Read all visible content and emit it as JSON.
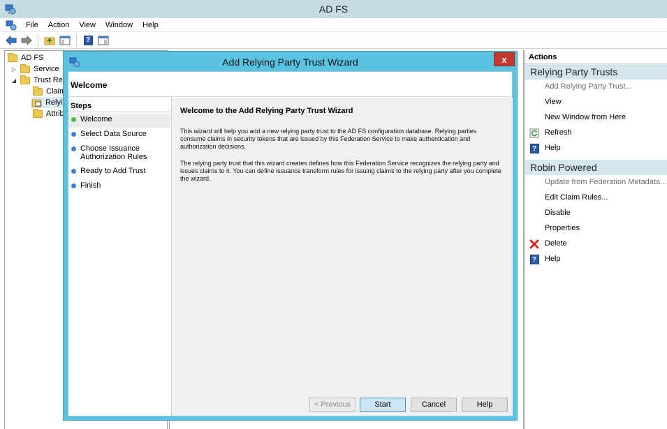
{
  "window": {
    "title": "AD FS"
  },
  "menu": [
    "File",
    "Action",
    "View",
    "Window",
    "Help"
  ],
  "tree": {
    "root": "AD FS",
    "items": [
      {
        "label": "Service",
        "expander": "▷"
      },
      {
        "label": "Trust Relationships",
        "expander": "◢"
      },
      {
        "label": "Claims Provider Trusts"
      },
      {
        "label": "Relying Party Trusts"
      },
      {
        "label": "Attribute Stores"
      }
    ]
  },
  "actions": {
    "header": "Actions",
    "section1": {
      "title": "Relying Party Trusts",
      "items": [
        {
          "label": "Add Relying Party Trust...",
          "icon": "",
          "disabled": true
        },
        {
          "label": "View",
          "icon": ""
        },
        {
          "label": "New Window from Here",
          "icon": ""
        },
        {
          "label": "Refresh",
          "icon": "refresh-icon"
        },
        {
          "label": "Help",
          "icon": "help-icon"
        }
      ]
    },
    "section2": {
      "title": "Robin Powered",
      "items": [
        {
          "label": "Update from Federation Metadata...",
          "icon": "",
          "disabled": true
        },
        {
          "label": "Edit Claim Rules...",
          "icon": ""
        },
        {
          "label": "Disable",
          "icon": ""
        },
        {
          "label": "Properties",
          "icon": ""
        },
        {
          "label": "Delete",
          "icon": "delete-icon"
        },
        {
          "label": "Help",
          "icon": "help-icon"
        }
      ]
    }
  },
  "wizard": {
    "title": "Add Relying Party Trust Wizard",
    "close": "x",
    "header": "Welcome",
    "steps_title": "Steps",
    "steps": [
      {
        "label": "Welcome",
        "current": true
      },
      {
        "label": "Select Data Source"
      },
      {
        "label": "Choose Issuance Authorization Rules"
      },
      {
        "label": "Ready to Add Trust"
      },
      {
        "label": "Finish"
      }
    ],
    "content_title": "Welcome to the Add Relying Party Trust Wizard",
    "paragraph1": "This wizard will help you add a new relying party trust to the AD FS configuration database.  Relying parties consume claims in security tokens that are issued by this Federation Service to make authentication and authorization decisions.",
    "paragraph2": "The relying party trust that this wizard creates defines how this Federation Service recognizes the relying party and issues claims to it. You can define issuance transform rules for issuing claims to the relying party after you complete the wizard.",
    "buttons": {
      "previous": "< Previous",
      "start": "Start",
      "cancel": "Cancel",
      "help": "Help"
    }
  },
  "colors": {
    "dialog_frame": "#5bc3e2",
    "close_button": "#c7382c",
    "actions_section": "#d5e6ec",
    "current_step": "#4cbb3e",
    "step_dot": "#3b7fd9"
  }
}
